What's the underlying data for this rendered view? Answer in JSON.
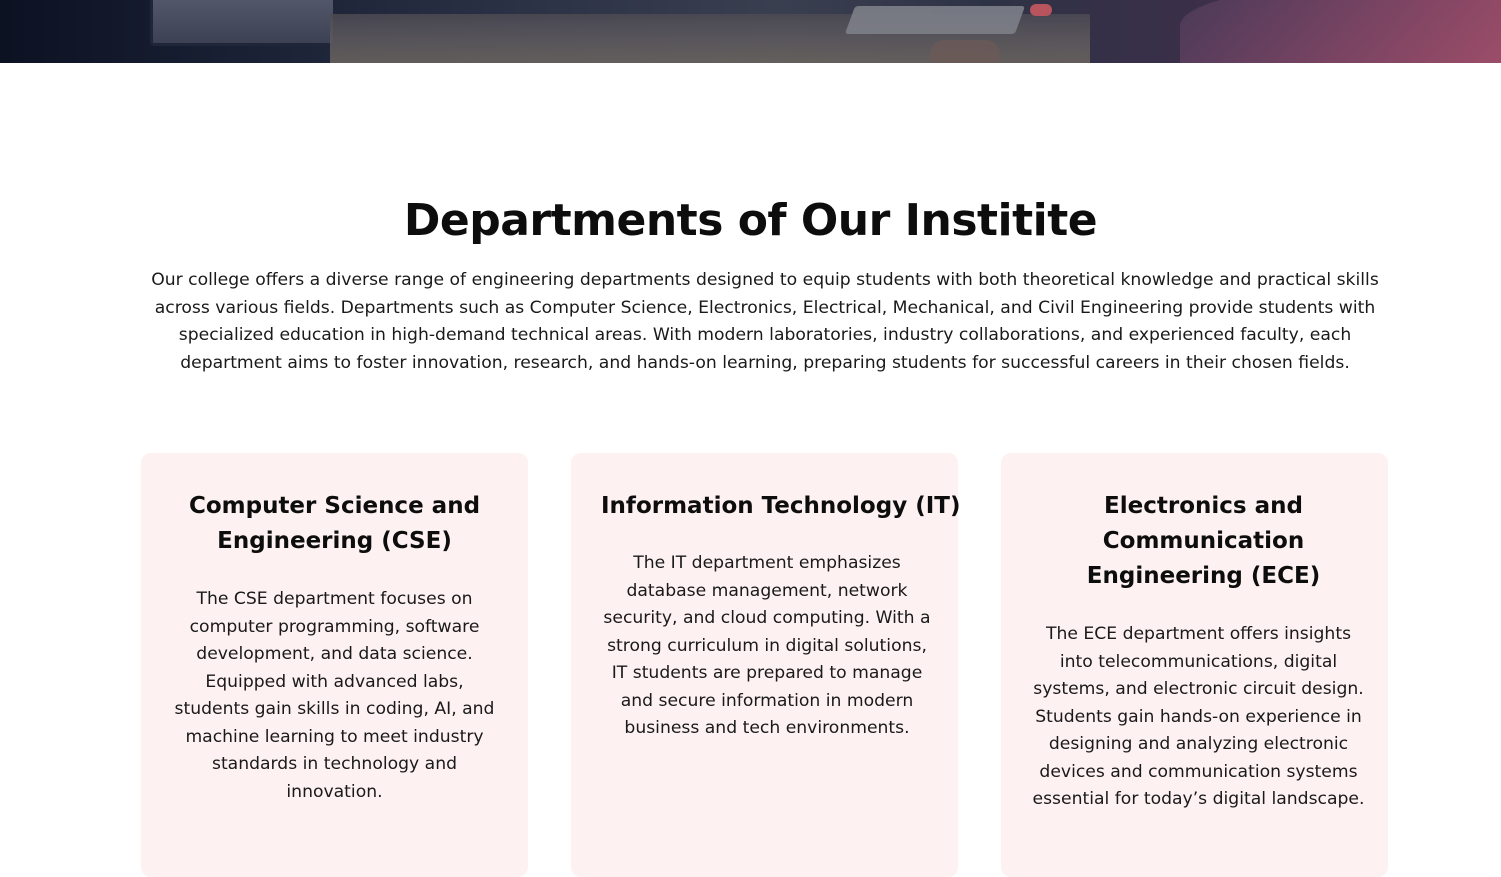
{
  "section": {
    "title": "Departments of Our Institite",
    "intro": "Our college offers a diverse range of engineering departments designed to equip students with both theoretical knowledge and practical skills across various fields. Departments such as Computer Science, Electronics, Electrical, Mechanical, and Civil Engineering provide students with specialized education in high-demand technical areas. With modern laboratories, industry collaborations, and experienced faculty, each department aims to foster innovation, research, and hands-on learning, preparing students for successful careers in their chosen fields."
  },
  "departments": [
    {
      "title": "Computer Science and Engineering (CSE)",
      "description": "The CSE department focuses on computer programming, software development, and data science. Equipped with advanced labs, students gain skills in coding, AI, and machine learning to meet industry standards in technology and innovation."
    },
    {
      "title": "Information Technology (IT)",
      "description": "The IT department emphasizes database management, network security, and cloud computing. With a strong curriculum in digital solutions, IT students are prepared to manage and secure information in modern business and tech environments."
    },
    {
      "title": "Electronics and Communication Engineering (ECE)",
      "description": "The ECE department offers insights into telecommunications, digital systems, and electronic circuit design. Students gain hands-on experience in designing and analyzing electronic devices and communication systems essential for today’s digital landscape."
    }
  ],
  "colors": {
    "card_background": "#fdf1f1",
    "heading": "#0d0d0d",
    "body_text": "#1a1a1a"
  }
}
